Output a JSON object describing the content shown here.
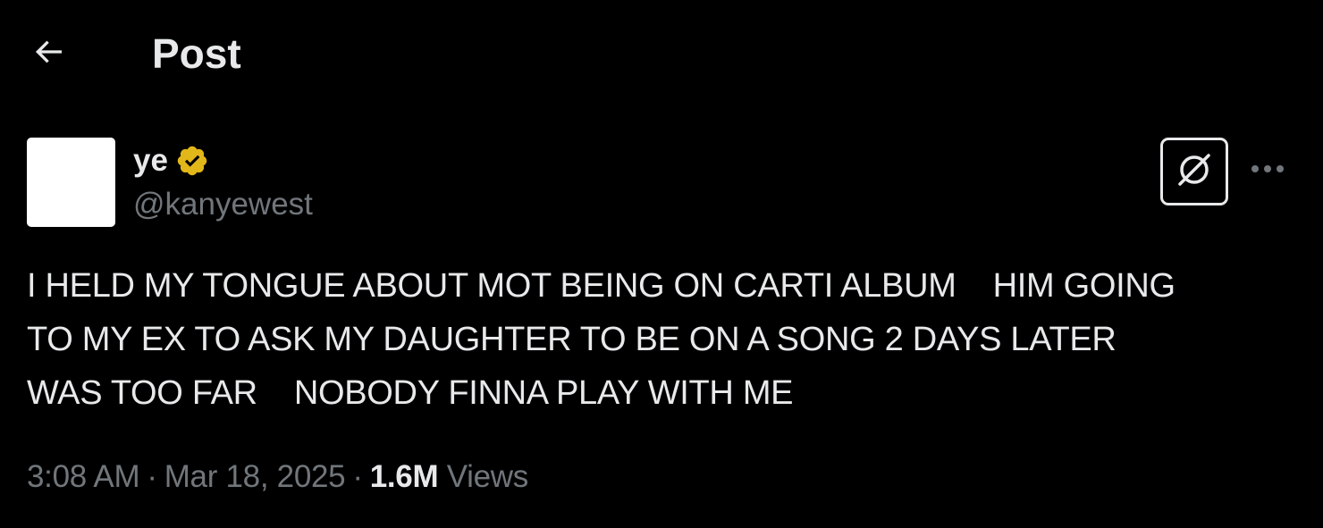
{
  "header": {
    "back_icon": "arrow-left-icon",
    "title": "Post"
  },
  "post": {
    "author": {
      "display_name": "ye",
      "handle": "@kanyewest",
      "verified_icon": "verified-badge-icon",
      "verified_color": "#e2b719"
    },
    "actions": {
      "grok_icon": "grok-icon",
      "more_icon": "more-horizontal-icon"
    },
    "text": "I HELD MY TONGUE ABOUT MOT BEING ON CARTI ALBUM    HIM GOING\nTO MY EX TO ASK MY DAUGHTER TO BE ON A SONG 2 DAYS LATER\nWAS TOO FAR    NOBODY FINNA PLAY WITH ME",
    "meta": {
      "time": "3:08 AM",
      "date": "Mar 18, 2025",
      "separator": "·",
      "views_count": "1.6M",
      "views_label": "Views"
    }
  },
  "colors": {
    "background": "#000000",
    "primary_text": "#e7e9ea",
    "secondary_text": "#71767b"
  }
}
